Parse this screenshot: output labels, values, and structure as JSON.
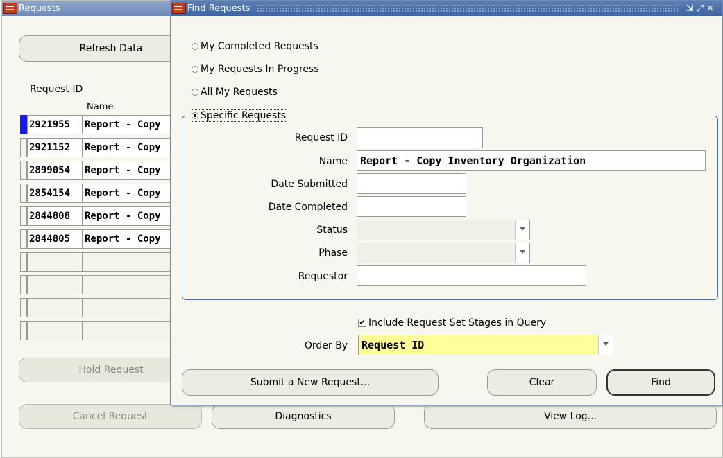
{
  "requests_window": {
    "title": "Requests",
    "refresh_label": "Refresh Data",
    "col_request_id": "Request ID",
    "col_name": "Name",
    "rows": [
      {
        "id": "2921955",
        "name": "Report - Copy"
      },
      {
        "id": "2921152",
        "name": "Report - Copy"
      },
      {
        "id": "2899054",
        "name": "Report - Copy"
      },
      {
        "id": "2854154",
        "name": "Report - Copy"
      },
      {
        "id": "2844808",
        "name": "Report - Copy"
      },
      {
        "id": "2844805",
        "name": "Report - Copy"
      }
    ],
    "hold_label": "Hold Request",
    "cancel_label": "Cancel Request",
    "diagnostics_label": "Diagnostics",
    "viewlog_label": "View Log..."
  },
  "find_dialog": {
    "title": "Find Requests",
    "radio_completed": "My Completed Requests",
    "radio_in_progress": "My Requests In Progress",
    "radio_all": "All My Requests",
    "radio_specific": "Specific Requests",
    "labels": {
      "request_id": "Request ID",
      "name": "Name",
      "date_submitted": "Date Submitted",
      "date_completed": "Date Completed",
      "status": "Status",
      "phase": "Phase",
      "requestor": "Requestor"
    },
    "values": {
      "request_id": "",
      "name": "Report - Copy Inventory Organization",
      "date_submitted": "",
      "date_completed": "",
      "status": "",
      "phase": "",
      "requestor": ""
    },
    "include_stages_label": "Include Request Set Stages in Query",
    "include_stages_checked": "✔",
    "order_by_label": "Order By",
    "order_by_value": "Request ID",
    "submit_new_label": "Submit a New Request...",
    "clear_label": "Clear",
    "find_label": "Find"
  }
}
